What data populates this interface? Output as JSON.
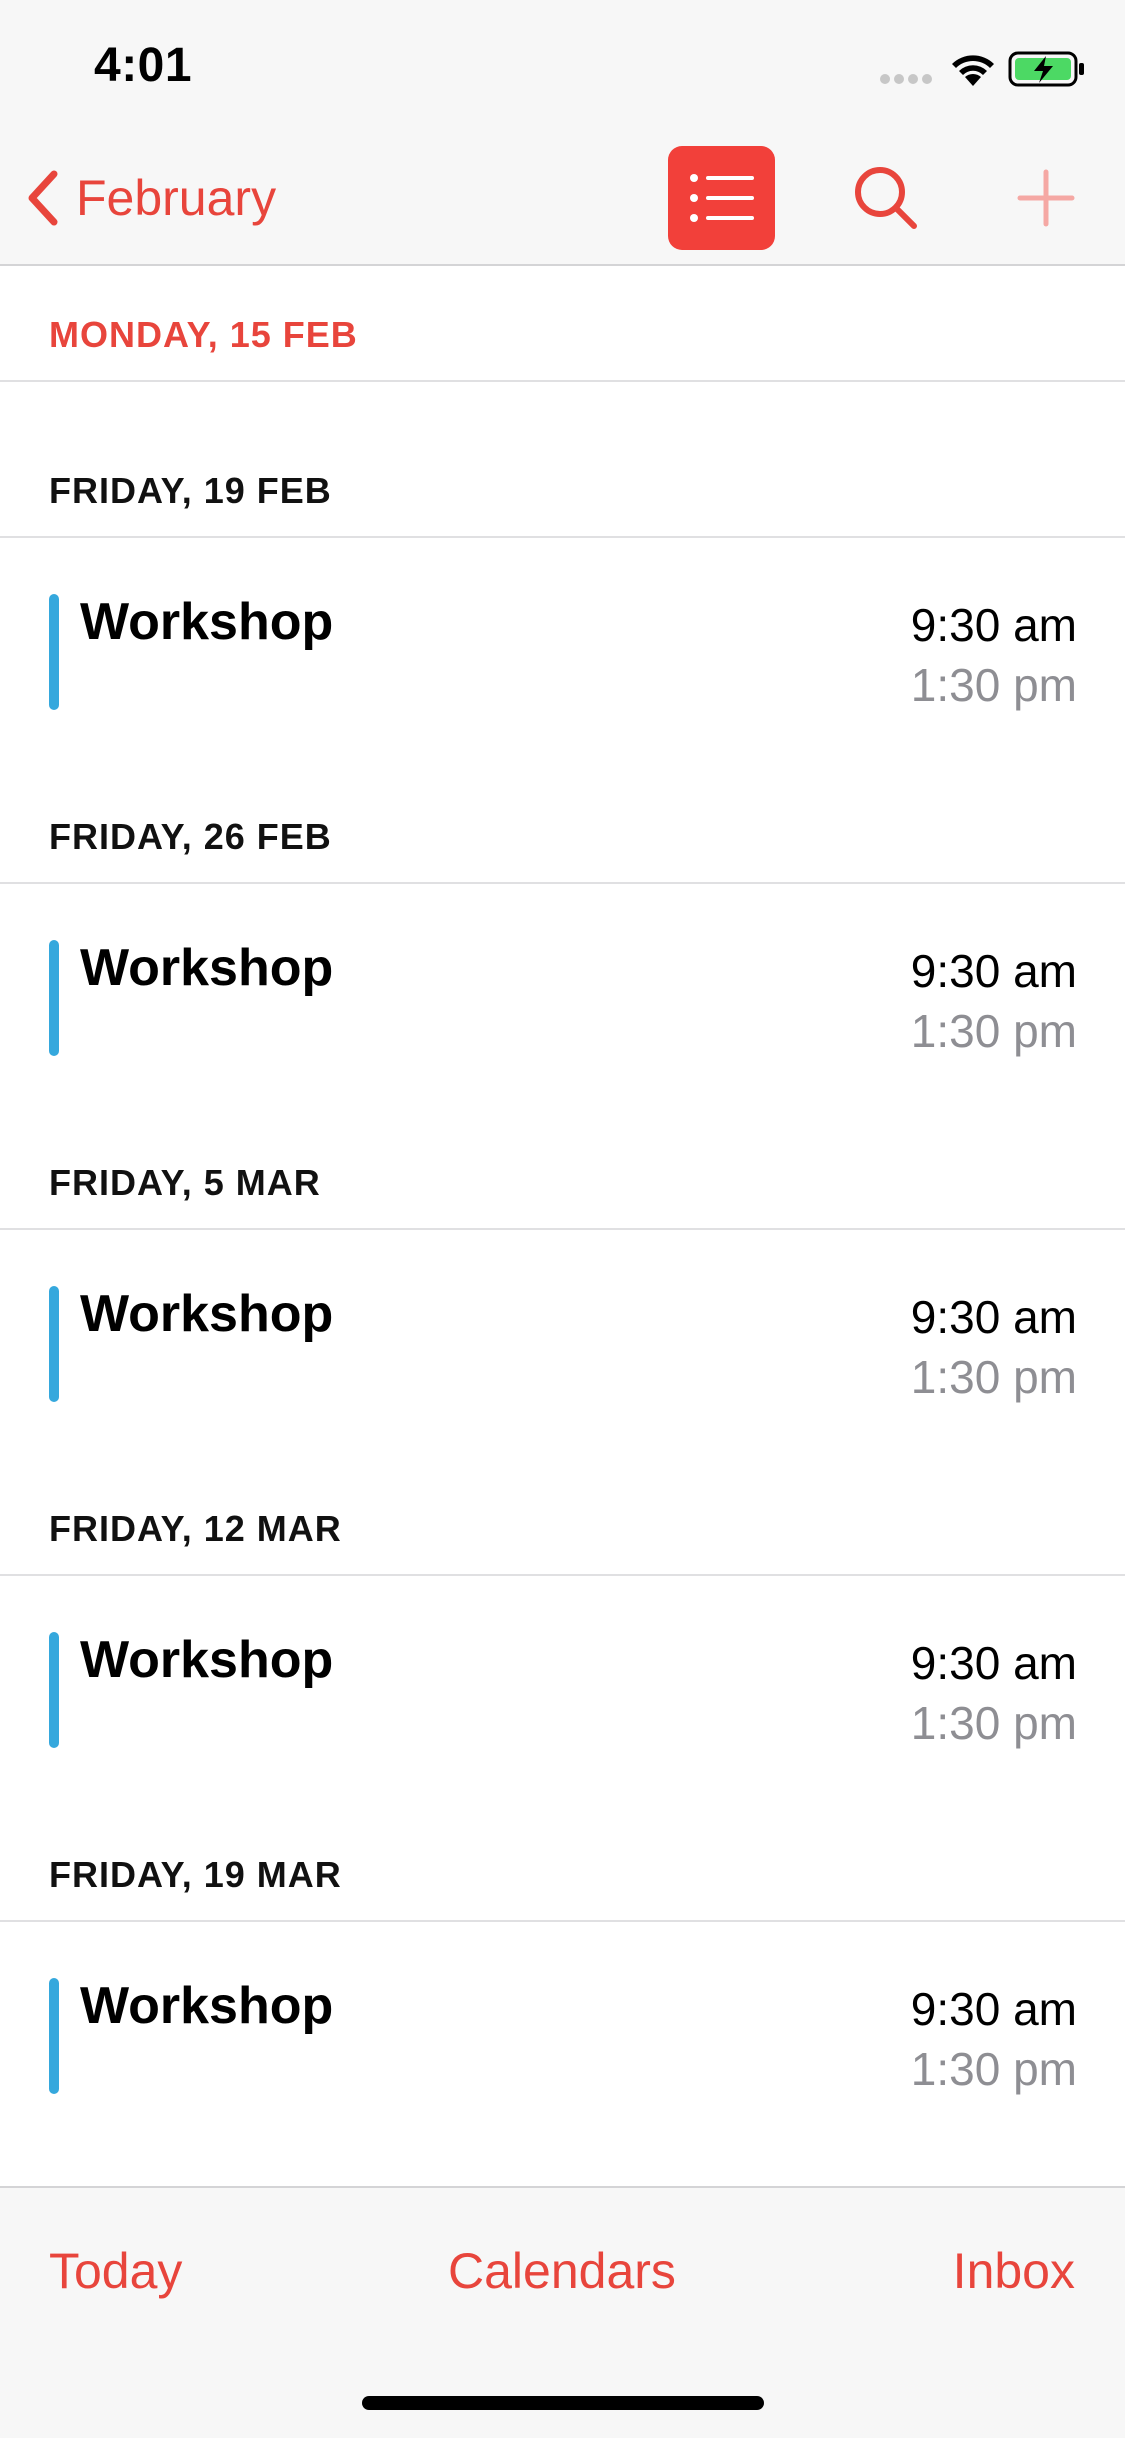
{
  "status_bar": {
    "time": "4:01",
    "icons": [
      "signal-icon",
      "wifi-icon",
      "battery-charging-icon"
    ]
  },
  "nav": {
    "back_label": "February",
    "icons": [
      "chevron-left-icon",
      "list-icon",
      "search-icon",
      "plus-icon"
    ]
  },
  "colors": {
    "accent": "#e8453c",
    "list_button_bg": "#f2403a",
    "event_bar": "#35a8dd",
    "secondary_text": "#8e8e93",
    "battery_green": "#4cd964"
  },
  "days": [
    {
      "label": "MONDAY, 15 FEB",
      "is_today": true,
      "events": []
    },
    {
      "label": "FRIDAY, 19 FEB",
      "is_today": false,
      "events": [
        {
          "title": "Workshop",
          "start": "9:30 am",
          "end": "1:30 pm"
        }
      ]
    },
    {
      "label": "FRIDAY, 26 FEB",
      "is_today": false,
      "events": [
        {
          "title": "Workshop",
          "start": "9:30 am",
          "end": "1:30 pm"
        }
      ]
    },
    {
      "label": "FRIDAY, 5 MAR",
      "is_today": false,
      "events": [
        {
          "title": "Workshop",
          "start": "9:30 am",
          "end": "1:30 pm"
        }
      ]
    },
    {
      "label": "FRIDAY, 12 MAR",
      "is_today": false,
      "events": [
        {
          "title": "Workshop",
          "start": "9:30 am",
          "end": "1:30 pm"
        }
      ]
    },
    {
      "label": "FRIDAY, 19 MAR",
      "is_today": false,
      "events": [
        {
          "title": "Workshop",
          "start": "9:30 am",
          "end": "1:30 pm"
        }
      ]
    }
  ],
  "tab_bar": {
    "today": "Today",
    "calendars": "Calendars",
    "inbox": "Inbox"
  }
}
